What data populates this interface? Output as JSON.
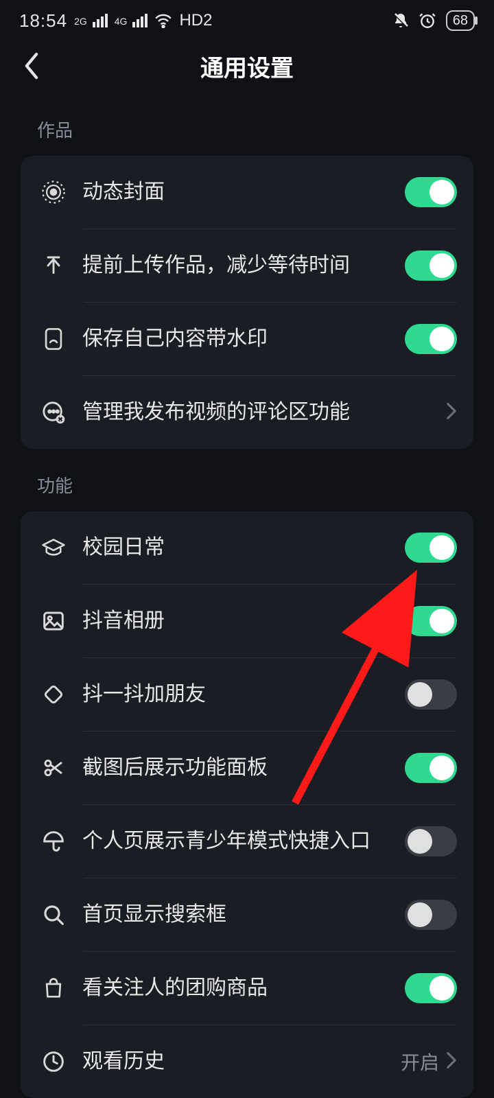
{
  "status": {
    "time": "18:54",
    "net1": "2G",
    "net2": "4G",
    "hd": "HD2",
    "battery": "68"
  },
  "header": {
    "title": "通用设置"
  },
  "sections": [
    {
      "label": "作品",
      "items": [
        {
          "icon": "target-icon",
          "label": "动态封面",
          "type": "toggle",
          "on": true
        },
        {
          "icon": "upload-icon",
          "label": "提前上传作品，减少等待时间",
          "type": "toggle",
          "on": true
        },
        {
          "icon": "tablet-icon",
          "label": "保存自己内容带水印",
          "type": "toggle",
          "on": true
        },
        {
          "icon": "comment-gear-icon",
          "label": "管理我发布视频的评论区功能",
          "type": "link"
        }
      ]
    },
    {
      "label": "功能",
      "items": [
        {
          "icon": "graduation-icon",
          "label": "校园日常",
          "type": "toggle",
          "on": true
        },
        {
          "icon": "image-icon",
          "label": "抖音相册",
          "type": "toggle",
          "on": true
        },
        {
          "icon": "shake-icon",
          "label": "抖一抖加朋友",
          "type": "toggle",
          "on": false
        },
        {
          "icon": "scissors-icon",
          "label": "截图后展示功能面板",
          "type": "toggle",
          "on": true
        },
        {
          "icon": "umbrella-icon",
          "label": "个人页展示青少年模式快捷入口",
          "type": "toggle",
          "on": false
        },
        {
          "icon": "search-icon",
          "label": "首页显示搜索框",
          "type": "toggle",
          "on": false
        },
        {
          "icon": "bag-icon",
          "label": "看关注人的团购商品",
          "type": "toggle",
          "on": true
        },
        {
          "icon": "clock-icon",
          "label": "观看历史",
          "type": "link",
          "value": "开启"
        }
      ]
    }
  ],
  "annotation": {
    "arrow_color": "#ff1a1a"
  }
}
